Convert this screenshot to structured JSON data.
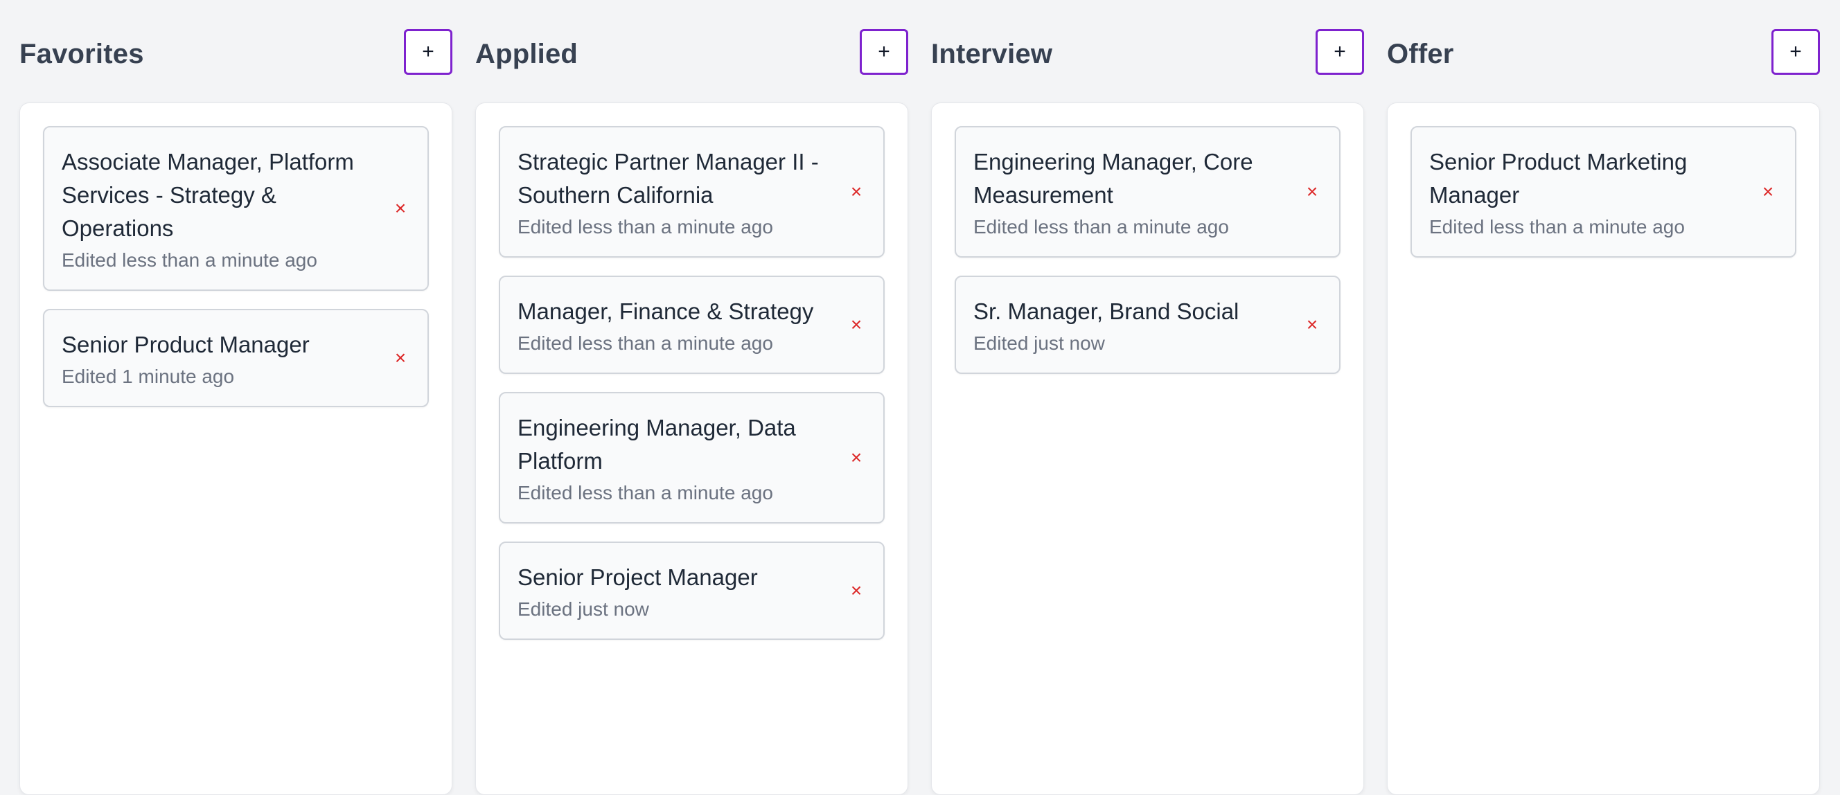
{
  "columns": [
    {
      "title": "Favorites",
      "add_label": "+",
      "cards": [
        {
          "title": "Associate Manager, Platform Services - Strategy & Operations",
          "meta": "Edited less than a minute ago",
          "remove": "×"
        },
        {
          "title": "Senior Product Manager",
          "meta": "Edited 1 minute ago",
          "remove": "×"
        }
      ]
    },
    {
      "title": "Applied",
      "add_label": "+",
      "cards": [
        {
          "title": "Strategic Partner Manager II - Southern California",
          "meta": "Edited less than a minute ago",
          "remove": "×"
        },
        {
          "title": "Manager, Finance & Strategy",
          "meta": "Edited less than a minute ago",
          "remove": "×"
        },
        {
          "title": "Engineering Manager, Data Platform",
          "meta": "Edited less than a minute ago",
          "remove": "×"
        },
        {
          "title": "Senior Project Manager",
          "meta": "Edited just now",
          "remove": "×"
        }
      ]
    },
    {
      "title": "Interview",
      "add_label": "+",
      "cards": [
        {
          "title": "Engineering Manager, Core Measurement",
          "meta": "Edited less than a minute ago",
          "remove": "×"
        },
        {
          "title": "Sr. Manager, Brand Social",
          "meta": "Edited just now",
          "remove": "×"
        }
      ]
    },
    {
      "title": "Offer",
      "add_label": "+",
      "cards": [
        {
          "title": "Senior Product Marketing Manager",
          "meta": "Edited less than a minute ago",
          "remove": "×"
        }
      ]
    }
  ],
  "colors": {
    "background": "#f3f4f6",
    "accent": "#7e22ce",
    "remove": "#dc2626",
    "meta_text": "#6b7280"
  },
  "icons": {
    "add": "plus-icon",
    "remove": "close-icon"
  }
}
